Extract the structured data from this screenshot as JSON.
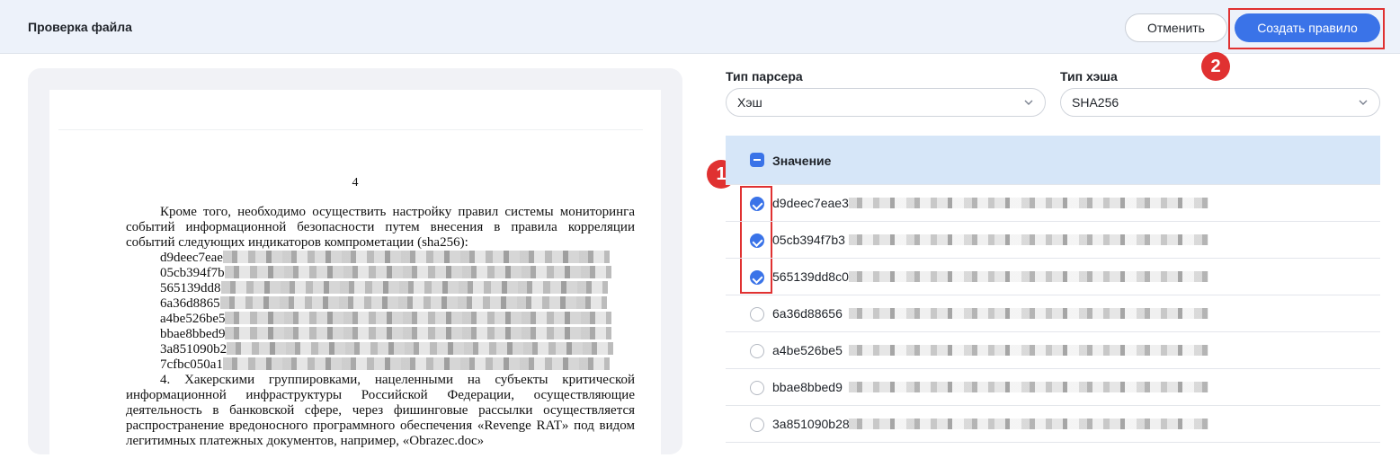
{
  "header": {
    "title": "Проверка файла",
    "cancel_label": "Отменить",
    "create_label": "Создать правило"
  },
  "callouts": {
    "step1": "1",
    "step2": "2"
  },
  "document": {
    "page_number": "4",
    "paragraph1": "Кроме того, необходимо осуществить настройку правил системы мониторинга событий информационной безопасности путем внесения в правила корреляции событий следующих индикаторов компрометации (sha256):",
    "hash_lines": [
      "d9deec7eae",
      "05cb394f7b",
      "565139dd8",
      "6a36d8865",
      "a4be526be5",
      "bbae8bbed9",
      "3a851090b2",
      "7cfbc050a1"
    ],
    "paragraph2": "4. Хакерскими группировками, нацеленными на субъекты критической информационной инфраструктуры Российской Федерации, осуществляющие деятельность в банковской сфере, через фишинговые рассылки осуществляется распространение вредоносного программного обеспечения «Revenge RAT» под видом легитимных платежных документов, например, «Obrazec.doc»"
  },
  "form": {
    "parser_label": "Тип парсера",
    "parser_value": "Хэш",
    "hash_label": "Тип хэша",
    "hash_value": "SHA256"
  },
  "table": {
    "column_title": "Значение",
    "rows": [
      {
        "value": "d9deec7eae3",
        "checked": true
      },
      {
        "value": "05cb394f7b3",
        "checked": true
      },
      {
        "value": "565139dd8c0",
        "checked": true
      },
      {
        "value": "6a36d88656",
        "checked": false
      },
      {
        "value": "a4be526be5",
        "checked": false
      },
      {
        "value": "bbae8bbed9",
        "checked": false
      },
      {
        "value": "3a851090b28",
        "checked": false
      }
    ]
  },
  "colors": {
    "primary": "#3a73e8",
    "header_bg": "#edf2fa",
    "table_header_bg": "#d6e6f8",
    "callout": "#e03131"
  },
  "icons": {
    "dropdown": "chevron-down-icon",
    "select_all": "minus-checkbox-icon",
    "row_check": "checkbox-icon"
  }
}
